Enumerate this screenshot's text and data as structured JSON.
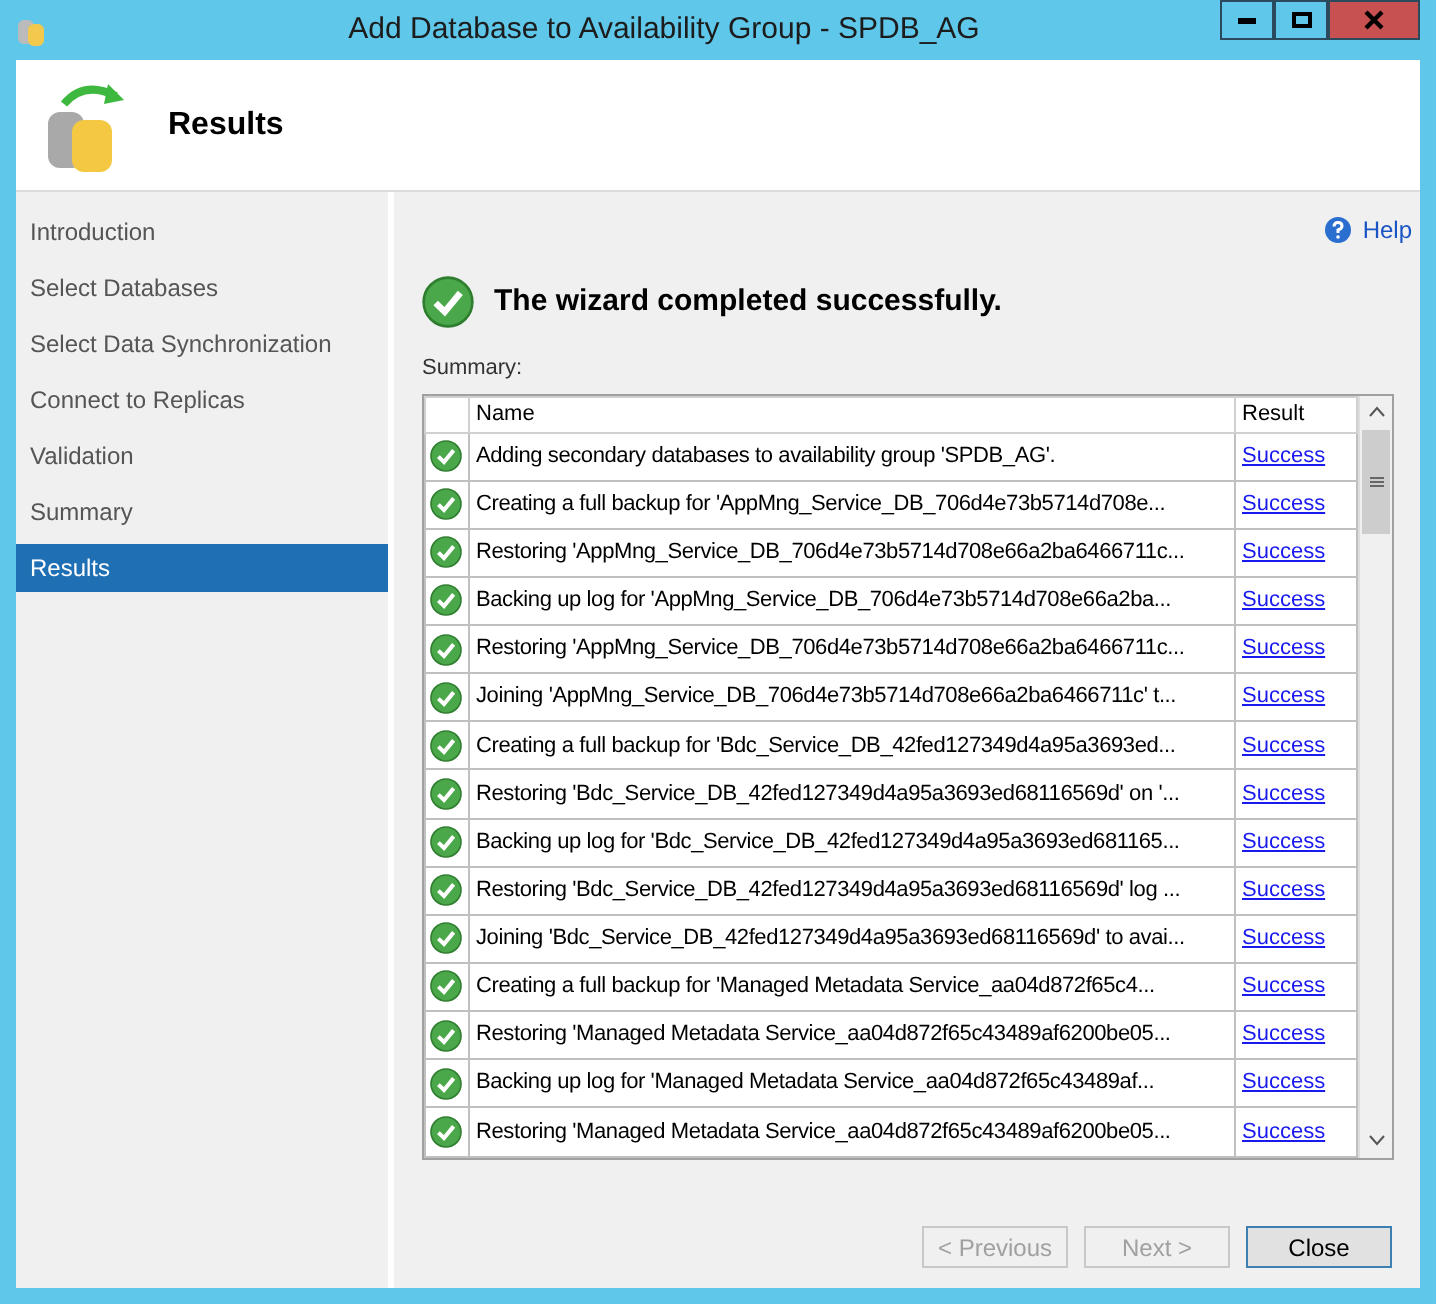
{
  "window": {
    "title": "Add Database to Availability Group - SPDB_AG"
  },
  "header": {
    "title": "Results"
  },
  "sidebar": {
    "items": [
      {
        "label": "Introduction",
        "selected": false
      },
      {
        "label": "Select Databases",
        "selected": false
      },
      {
        "label": "Select Data Synchronization",
        "selected": false
      },
      {
        "label": "Connect to Replicas",
        "selected": false
      },
      {
        "label": "Validation",
        "selected": false
      },
      {
        "label": "Summary",
        "selected": false
      },
      {
        "label": "Results",
        "selected": true
      }
    ]
  },
  "help": "Help",
  "status": "The wizard completed successfully.",
  "summary_label": "Summary:",
  "table": {
    "columns": [
      "Name",
      "Result"
    ],
    "rows": [
      {
        "name": "Adding secondary databases to availability group 'SPDB_AG'.",
        "result": "Success"
      },
      {
        "name": "Creating a full backup for 'AppMng_Service_DB_706d4e73b5714d708e...",
        "result": "Success"
      },
      {
        "name": "Restoring 'AppMng_Service_DB_706d4e73b5714d708e66a2ba6466711c...",
        "result": "Success"
      },
      {
        "name": "Backing up log for 'AppMng_Service_DB_706d4e73b5714d708e66a2ba...",
        "result": "Success"
      },
      {
        "name": "Restoring 'AppMng_Service_DB_706d4e73b5714d708e66a2ba6466711c...",
        "result": "Success"
      },
      {
        "name": "Joining 'AppMng_Service_DB_706d4e73b5714d708e66a2ba6466711c' t...",
        "result": "Success"
      },
      {
        "name": "Creating a full backup for 'Bdc_Service_DB_42fed127349d4a95a3693ed...",
        "result": "Success"
      },
      {
        "name": "Restoring 'Bdc_Service_DB_42fed127349d4a95a3693ed68116569d' on '...",
        "result": "Success"
      },
      {
        "name": "Backing up log for 'Bdc_Service_DB_42fed127349d4a95a3693ed681165...",
        "result": "Success"
      },
      {
        "name": "Restoring 'Bdc_Service_DB_42fed127349d4a95a3693ed68116569d' log ...",
        "result": "Success"
      },
      {
        "name": "Joining 'Bdc_Service_DB_42fed127349d4a95a3693ed68116569d' to avai...",
        "result": "Success"
      },
      {
        "name": "Creating a full backup for 'Managed Metadata Service_aa04d872f65c4...",
        "result": "Success"
      },
      {
        "name": "Restoring 'Managed Metadata Service_aa04d872f65c43489af6200be05...",
        "result": "Success"
      },
      {
        "name": "Backing up log for 'Managed Metadata Service_aa04d872f65c43489af...",
        "result": "Success"
      },
      {
        "name": "Restoring 'Managed Metadata Service_aa04d872f65c43489af6200be05...",
        "result": "Success"
      }
    ]
  },
  "buttons": [
    {
      "label": "< Previous",
      "disabled": true
    },
    {
      "label": "Next >",
      "disabled": true
    },
    {
      "label": "Close",
      "disabled": false
    }
  ]
}
